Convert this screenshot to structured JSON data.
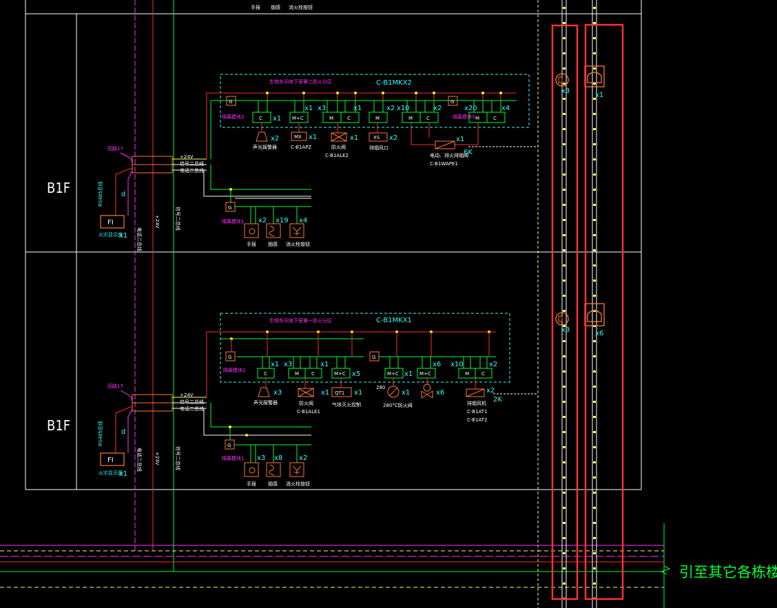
{
  "colors": {
    "background": "#000000",
    "frame": "#ffffff",
    "bus_red": "#ff2a2a",
    "bus_green": "#00ff33",
    "bus_magenta": "#ff33ff",
    "cyan": "#33ffff",
    "orange": "#ff7a33",
    "yellow": "#ffff00",
    "highlight": "#ff3333"
  },
  "top_legend": {
    "manual": "手报",
    "smoke": "烟感",
    "hydrant": "消火栓按钮"
  },
  "upper": {
    "floor": "B1F",
    "zone_title": "生物车间地下室第二防火分区",
    "panel_code": "C-B1MKX2",
    "isolator_1": "隔离模块2",
    "isolator_2": "隔离模块3",
    "isolator_lower": "隔离模块1",
    "loop": "回路17",
    "rs485": "RS485总线",
    "d": "d",
    "bus_24v": "+24V",
    "bus_signal": "信号二总线",
    "bus_power": "电话二总线",
    "vert_left": "电话二总线",
    "vert_mid": "+24V",
    "vert_right": "信号二总线",
    "fi": "FI",
    "fi_label": "火灾显示盘",
    "fi_count": "x1",
    "g": "G",
    "box_c1": "C",
    "box_mc": "M+C",
    "box_m1": "M",
    "box_c2": "C",
    "box_m2": "M",
    "box_m3": "M",
    "box_c3": "C",
    "box_m4": "M",
    "box_c4": "C",
    "mod_counts": [
      "x1",
      "x1",
      "x3",
      "x1",
      "x2",
      "x10",
      "x2",
      "x20",
      "x4"
    ],
    "dev_alarm_count": "x2",
    "dev_alarm": "声光报警器",
    "dev_mx": "MX",
    "dev_mx_count": "x1",
    "dev_mx_label": "C-B1APZ",
    "dev_fan_count": "x1",
    "dev_fan": "防火阀",
    "dev_fan_label": "C-B1ALE2",
    "dev_xs": "XS",
    "dev_xs_count": "x2",
    "dev_xs_label": "排烟风口",
    "dev_valve_count": "x1",
    "dev_valve": "电动、排火排烟阀",
    "dev_valve_label": "C-B1WAPE1",
    "dev_valve_6k": "6K",
    "lower_counts": [
      "x2",
      "x19",
      "x4"
    ],
    "lower_labels": [
      "手报",
      "烟感",
      "消火栓按钮"
    ]
  },
  "lower": {
    "floor": "B1F",
    "zone_title": "生物车间地下室第一防火分区",
    "panel_code": "C-B1MKX1",
    "isolator_1": "隔离模块2",
    "isolator_lower": "隔离模块1",
    "loop": "回路17",
    "rs485": "RS485总线",
    "d": "d",
    "bus_24v": "+24V",
    "bus_signal": "信号二总线",
    "bus_power": "电话二总线",
    "vert_left": "电话二总线",
    "vert_mid": "+24V",
    "vert_right": "信号二总线",
    "fi": "FI",
    "fi_label": "火灾显示盘",
    "fi_count": "x1",
    "g": "G",
    "box_c1": "C",
    "box_m1": "M",
    "box_c2": "C",
    "box_mc1": "M+C",
    "box_mc2": "M+C",
    "box_mc3": "M+C",
    "box_m2": "M",
    "box_c3": "C",
    "mod_counts": [
      "x1",
      "x3",
      "x1",
      "x5",
      "x1",
      "x6",
      "x10",
      "x2"
    ],
    "dev_alarm_count": "x3",
    "dev_alarm": "声光报警器",
    "dev_fan_count": "x1",
    "dev_fan": "防火阀",
    "dev_fan_label": "C-B1ALE1",
    "dev_qt": "QT1",
    "dev_qt_count": "x1",
    "dev_qt_label": "气体灭火控制",
    "dev_280": "280",
    "dev_280_count": "x1",
    "dev_280_label": "280°C防火阀",
    "dev_pump_count": "x6",
    "dev_pump2_count": "x2",
    "dev_pump2_label": "排烟风机",
    "dev_pump2_a": "C-B1AT1",
    "dev_pump2_b": "C-B1AT2",
    "dev_pump2_2k": "2K",
    "lower_counts": [
      "x3",
      "x8",
      "x2"
    ],
    "lower_labels": [
      "手报",
      "烟感",
      "消火栓按钮"
    ]
  },
  "riser": {
    "speaker_count_upper": "x3",
    "phone_count_upper": "x1",
    "speaker_count_lower": "x3",
    "phone_count_lower": "x6"
  },
  "side_label": "引至其它各栋楼"
}
